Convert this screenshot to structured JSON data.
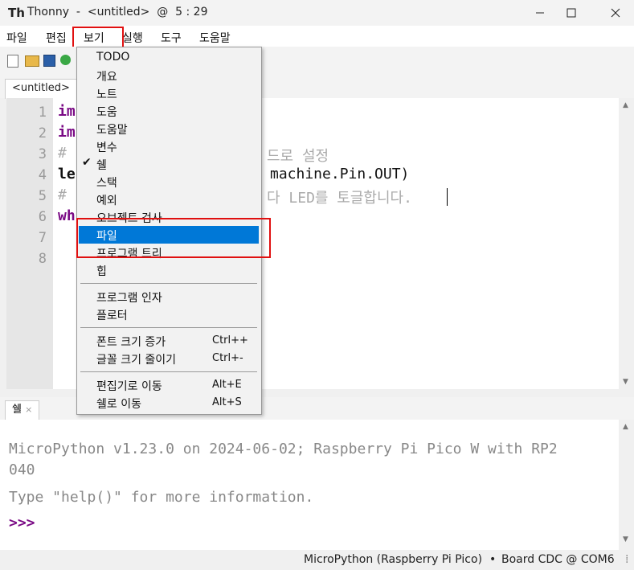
{
  "window": {
    "title": "Thonny  -  <untitled>  @  5 : 29",
    "minimize_icon": "minimize-icon",
    "maximize_icon": "maximize-icon",
    "close_icon": "close-icon"
  },
  "menu": {
    "items": [
      "파일",
      "편집",
      "보기",
      "실행",
      "도구",
      "도움말"
    ]
  },
  "editor_tab": {
    "label": "<untitled>",
    "close": "×"
  },
  "editor": {
    "line_numbers": [
      "1",
      "2",
      "3",
      "4",
      "5",
      "6",
      "7",
      "8"
    ],
    "lines": [
      {
        "text": "im",
        "color": "#7a0a85"
      },
      {
        "text": "im",
        "color": "#7a0a85"
      },
      {
        "text": "#",
        "color": "#aaaaaa"
      },
      {
        "text": "le",
        "color": "#111111"
      },
      {
        "text": "#",
        "color": "#aaaaaa"
      },
      {
        "text": "wh",
        "color": "#7a0a85"
      }
    ],
    "fragment_line3": "드로 설정",
    "fragment_line4": "machine.Pin.OUT)",
    "fragment_line5": "다 LED를 토글합니다."
  },
  "view_menu": {
    "items": [
      {
        "label": "TODO",
        "checked": false
      },
      {
        "label": "개요",
        "checked": false
      },
      {
        "label": "노트",
        "checked": false
      },
      {
        "label": "도움",
        "checked": false
      },
      {
        "label": "도움말",
        "checked": false
      },
      {
        "label": "변수",
        "checked": false
      },
      {
        "label": "쉘",
        "checked": true
      },
      {
        "label": "스택",
        "checked": false
      },
      {
        "label": "예외",
        "checked": false
      },
      {
        "label": "오브젝트 검사",
        "checked": false
      },
      {
        "label": "파일",
        "checked": false,
        "selected": true
      },
      {
        "label": "프로그램 트리",
        "checked": false
      },
      {
        "label": "힙",
        "checked": false
      }
    ],
    "group2": [
      "프로그램 인자",
      "플로터"
    ],
    "group3": [
      {
        "label": "폰트 크기 증가",
        "accel": "Ctrl++"
      },
      {
        "label": "글꼴 크기 줄이기",
        "accel": "Ctrl+-"
      }
    ],
    "group4": [
      {
        "label": "편집기로 이동",
        "accel": "Alt+E"
      },
      {
        "label": "쉘로 이동",
        "accel": "Alt+S"
      }
    ]
  },
  "shell_tab": {
    "label": "쉘",
    "close": "×"
  },
  "shell": {
    "line1": "MicroPython v1.23.0 on 2024-06-02; Raspberry Pi Pico W with RP2",
    "line2": "040",
    "line3": "Type \"help()\" for more information.",
    "prompt": ">>>"
  },
  "status": {
    "interpreter": "MicroPython (Raspberry Pi Pico)",
    "separator": "•",
    "port": "Board CDC @ COM6",
    "dots": "⁞"
  },
  "colors": {
    "accent": "#0078d7",
    "highlight_box": "#e01010",
    "keyword": "#7a0a85",
    "prompt": "#7a0a85"
  }
}
